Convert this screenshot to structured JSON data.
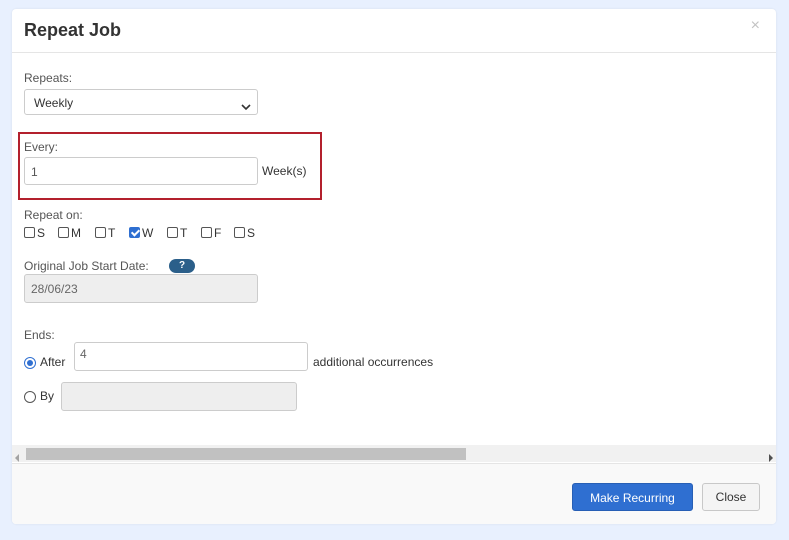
{
  "dialog": {
    "title": "Repeat Job",
    "close_glyph": "×"
  },
  "repeats": {
    "label": "Repeats:",
    "value": "Weekly"
  },
  "every": {
    "label": "Every:",
    "value": "1",
    "unit": "Week(s)"
  },
  "repeat_on": {
    "label": "Repeat on:",
    "days": [
      {
        "label": "S",
        "checked": false
      },
      {
        "label": "M",
        "checked": false
      },
      {
        "label": "T",
        "checked": false
      },
      {
        "label": "W",
        "checked": true
      },
      {
        "label": "T",
        "checked": false
      },
      {
        "label": "F",
        "checked": false
      },
      {
        "label": "S",
        "checked": false
      }
    ]
  },
  "original_start": {
    "label": "Original Job Start Date:",
    "help_glyph": "?",
    "value": "28/06/23"
  },
  "ends": {
    "label": "Ends:",
    "after_label": "After",
    "after_value": "4",
    "after_suffix": "additional occurrences",
    "after_selected": true,
    "by_label": "By",
    "by_value": "",
    "by_selected": false
  },
  "footer": {
    "primary_label": "Make Recurring",
    "close_label": "Close"
  },
  "colors": {
    "accent": "#2f6fd1",
    "highlight_border": "#b3202d",
    "background": "#e8f0fe"
  }
}
